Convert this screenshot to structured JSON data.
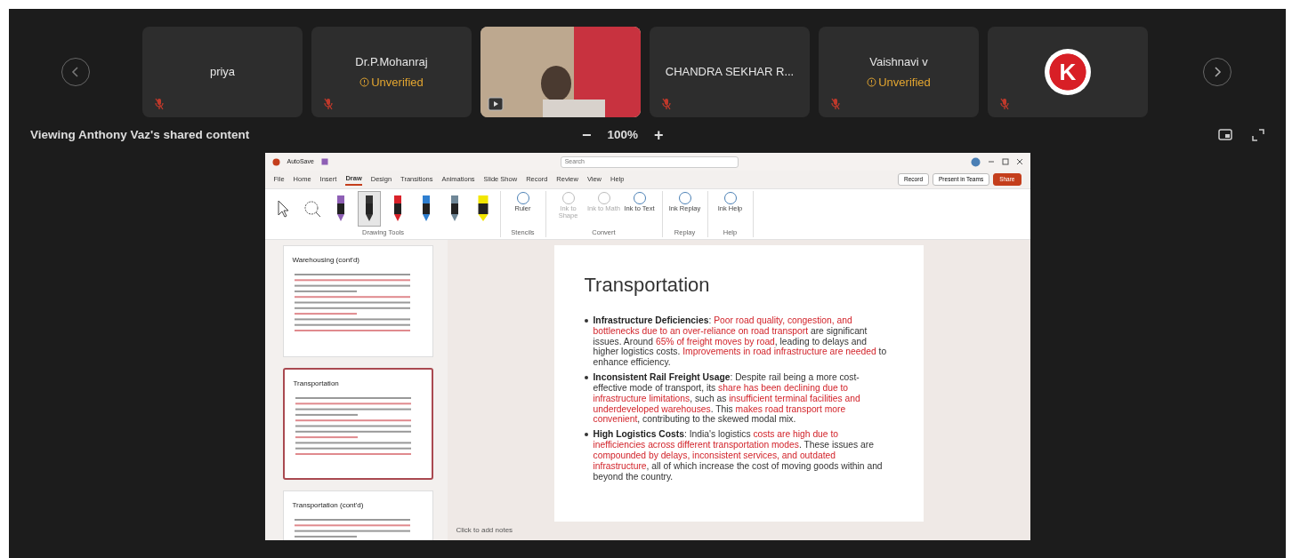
{
  "meeting": {
    "participants": [
      {
        "kind": "name",
        "name": "priya",
        "muted": true
      },
      {
        "kind": "name",
        "name": "Dr.P.Mohanraj",
        "status": "Unverified",
        "muted": true
      },
      {
        "kind": "video"
      },
      {
        "kind": "name",
        "name": "CHANDRA SEKHAR R...",
        "muted": true
      },
      {
        "kind": "name",
        "name": "Vaishnavi v",
        "status": "Unverified",
        "muted": true
      },
      {
        "kind": "logo",
        "logo_text": "K",
        "muted": true
      }
    ],
    "viewing": "Viewing Anthony Vaz's shared content",
    "zoom_out": "−",
    "zoom": "100%",
    "zoom_in": "+"
  },
  "presentation": {
    "autosave": "AutoSave",
    "search": {
      "placeholder": "Search"
    },
    "ribbon_tabs": [
      {
        "label": "File",
        "selected": false
      },
      {
        "label": "Home",
        "selected": false
      },
      {
        "label": "Insert",
        "selected": false
      },
      {
        "label": "Draw",
        "selected": true
      },
      {
        "label": "Design",
        "selected": false
      },
      {
        "label": "Transitions",
        "selected": false
      },
      {
        "label": "Animations",
        "selected": false
      },
      {
        "label": "Slide Show",
        "selected": false
      },
      {
        "label": "Record",
        "selected": false
      },
      {
        "label": "Review",
        "selected": false
      },
      {
        "label": "View",
        "selected": false
      },
      {
        "label": "Help",
        "selected": false
      }
    ],
    "actions": [
      {
        "label": "Record",
        "kind": "outline"
      },
      {
        "label": "Present in Teams",
        "kind": "outline"
      },
      {
        "label": "Share",
        "kind": "primary"
      }
    ],
    "drawing_tools": {
      "label": "Drawing Tools",
      "tools": [
        {
          "kind": "select",
          "selected": false
        },
        {
          "kind": "lasso",
          "selected": false
        },
        {
          "kind": "pen",
          "color": "#8e5fb5",
          "selected": false
        },
        {
          "kind": "pen",
          "color": "#333333",
          "selected": true
        },
        {
          "kind": "pen",
          "color": "#d9222a",
          "selected": false
        },
        {
          "kind": "pen",
          "color": "#2f7fd0",
          "selected": false
        },
        {
          "kind": "pen",
          "color": "#6f8797",
          "selected": false
        },
        {
          "kind": "highlighter",
          "color": "#f2e600",
          "selected": false
        }
      ]
    },
    "groups": [
      {
        "label": "Stencils",
        "buttons": [
          {
            "label": "Ruler",
            "disabled": false
          }
        ]
      },
      {
        "label": "Convert",
        "buttons": [
          {
            "label": "Ink to Shape",
            "disabled": true
          },
          {
            "label": "Ink to Math",
            "disabled": true
          },
          {
            "label": "Ink to Text",
            "disabled": false
          }
        ]
      },
      {
        "label": "Replay",
        "buttons": [
          {
            "label": "Ink Replay",
            "disabled": false
          }
        ]
      },
      {
        "label": "Help",
        "buttons": [
          {
            "label": "Ink Help",
            "disabled": false
          }
        ]
      }
    ],
    "thumbnails": [
      {
        "title": "Warehousing (cont'd)",
        "selected": false
      },
      {
        "title": "Transportation",
        "selected": true
      },
      {
        "title": "Transportation (cont'd)",
        "selected": false
      }
    ],
    "slide": {
      "title": "Transportation",
      "bullets": [
        {
          "label": "Infrastructure Deficiencies",
          "segments": [
            {
              "text": ": ",
              "highlighted": false
            },
            {
              "text": "Poor road quality, congestion, and bottlenecks due to an over-reliance on road transport",
              "highlighted": true
            },
            {
              "text": " are significant issues. Around ",
              "highlighted": false
            },
            {
              "text": "65% of freight moves by road",
              "highlighted": true
            },
            {
              "text": ", leading to delays and higher logistics costs. ",
              "highlighted": false
            },
            {
              "text": "Improvements in road infrastructure are needed",
              "highlighted": true
            },
            {
              "text": " to enhance efficiency.",
              "highlighted": false
            }
          ]
        },
        {
          "label": "Inconsistent Rail Freight Usage",
          "segments": [
            {
              "text": ": Despite rail being a more cost-effective mode of transport, its ",
              "highlighted": false
            },
            {
              "text": "share has been declining due to infrastructure limitations",
              "highlighted": true
            },
            {
              "text": ", such as ",
              "highlighted": false
            },
            {
              "text": "insufficient terminal facilities and underdeveloped warehouses",
              "highlighted": true
            },
            {
              "text": ". This ",
              "highlighted": false
            },
            {
              "text": "makes road transport more convenient",
              "highlighted": true
            },
            {
              "text": ", contributing to the skewed modal mix.",
              "highlighted": false
            }
          ]
        },
        {
          "label": "High Logistics Costs",
          "segments": [
            {
              "text": ": India's logistics ",
              "highlighted": false
            },
            {
              "text": "costs are high due to inefficiencies across different transportation modes",
              "highlighted": true
            },
            {
              "text": ". These issues are ",
              "highlighted": false
            },
            {
              "text": "compounded by delays, inconsistent services, and outdated infrastructure",
              "highlighted": true
            },
            {
              "text": ", all of which increase the cost of moving goods within and beyond the country.",
              "highlighted": false
            }
          ]
        }
      ]
    },
    "notes": {
      "placeholder": "Click to add notes"
    }
  }
}
